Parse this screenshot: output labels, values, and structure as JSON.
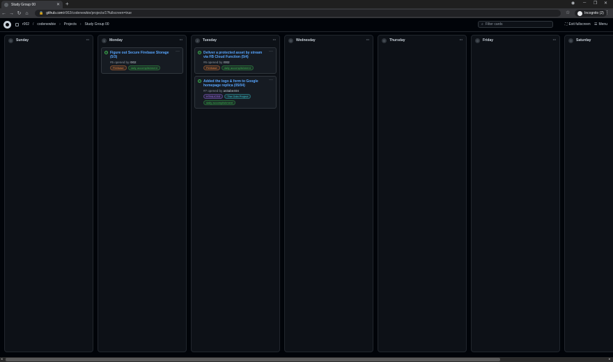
{
  "browser": {
    "tab_title": "Study Group 00",
    "tab_close": "✕",
    "new_tab": "+",
    "url_host": "github.com",
    "url_path": "/r002/codenewbie/projects/1?fullscreen=true",
    "profile_label": "Incognito (2)",
    "icons": [
      "back-icon",
      "forward-icon",
      "reload-icon",
      "home-icon",
      "lock-icon",
      "star-icon",
      "kebab-icon"
    ]
  },
  "header": {
    "owner": "r002",
    "repo": "codenewbie",
    "section": "Projects",
    "project": "Study Group 00",
    "filter_placeholder": "Filter cards",
    "exit_fullscreen": "Exit fullscreen",
    "menu": "Menu"
  },
  "columns": [
    {
      "name": "Sunday",
      "count": "0",
      "cards": []
    },
    {
      "name": "Monday",
      "count": "1",
      "cards": [
        {
          "title": "Figure out Secure Firebase Storage (5/3)",
          "meta_prefix": "#5 opened by",
          "author": "r002",
          "labels": [
            {
              "text": "Firebase",
              "color": "#f0883e"
            },
            {
              "text": "daily accomplishment",
              "color": "#3fb950"
            }
          ]
        }
      ]
    },
    {
      "name": "Tuesday",
      "count": "2",
      "cards": [
        {
          "title": "Deliver a protected asset by stream via FB Cloud Function (5/4)",
          "meta_prefix": "#6 opened by",
          "author": "r002",
          "labels": [
            {
              "text": "Firebase",
              "color": "#f0883e"
            },
            {
              "text": "daily accomplishment",
              "color": "#3fb950"
            }
          ]
        },
        {
          "title": "Added the logo & form to Google homepage replica (05/04)",
          "meta_prefix": "#7 opened by",
          "author": "anitabe404",
          "labels": [
            {
              "text": "HTML/CSS",
              "color": "#a371f7"
            },
            {
              "text": "The Odin Project",
              "color": "#39c5cf"
            },
            {
              "text": "daily accomplishment",
              "color": "#3fb950"
            }
          ]
        }
      ]
    },
    {
      "name": "Wednesday",
      "count": "0",
      "cards": []
    },
    {
      "name": "Thursday",
      "count": "0",
      "cards": []
    },
    {
      "name": "Friday",
      "count": "0",
      "cards": []
    },
    {
      "name": "Saturday",
      "count": "0",
      "cards": []
    }
  ]
}
